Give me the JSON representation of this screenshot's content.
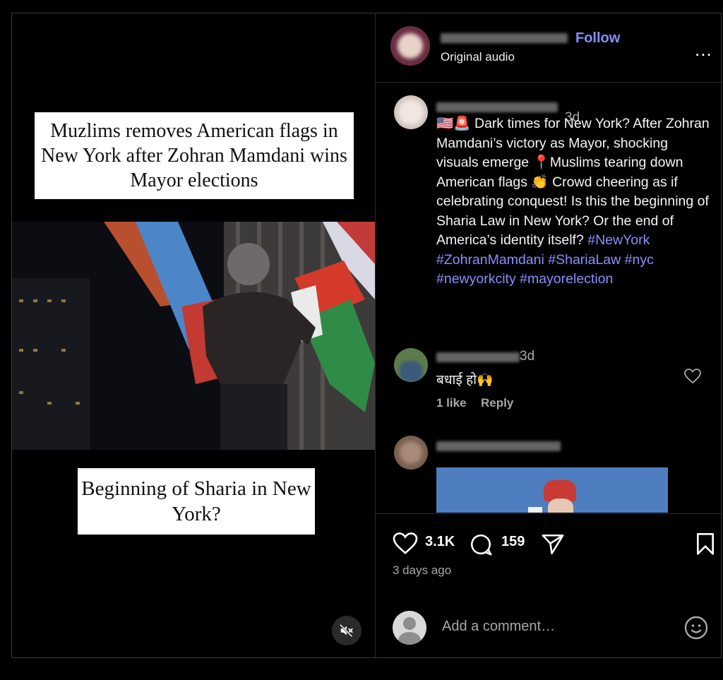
{
  "video": {
    "caption_top": "Muzlims removes American flags in New York after Zohran Mamdani wins Mayor elections",
    "caption_bottom": "Beginning of Sharia in New York?",
    "mute_icon": "speaker-muted-icon"
  },
  "header": {
    "follow_label": "Follow",
    "audio_label": "Original audio",
    "more_label": "..."
  },
  "post_caption": {
    "time": "3d",
    "flags": "🇺🇸🚨",
    "text_1": " Dark times for New York? After Zohran Mamdani’s victory as Mayor, shocking visuals emerge ",
    "pin": "📍",
    "text_2": "Muslims tearing down American flags ",
    "clap": "👏",
    "text_3": " Crowd cheering as if celebrating conquest! Is this the beginning of Sharia Law in New York? Or the end of America’s identity itself? ",
    "hashtags": "#NewYork #ZohranMamdani #ShariaLaw #nyc #newyorkcity #mayorelection"
  },
  "comment_1": {
    "time": "3d",
    "text": "बधाई हो🙌",
    "likes": "1 like",
    "reply_label": "Reply"
  },
  "actions": {
    "like_count": "3.1K",
    "comment_count": "159",
    "posted": "3 days ago",
    "add_comment_placeholder": "Add a comment…"
  },
  "colors": {
    "accent": "#8a8fff",
    "background": "#000000",
    "muted_text": "#a8a8a8"
  }
}
